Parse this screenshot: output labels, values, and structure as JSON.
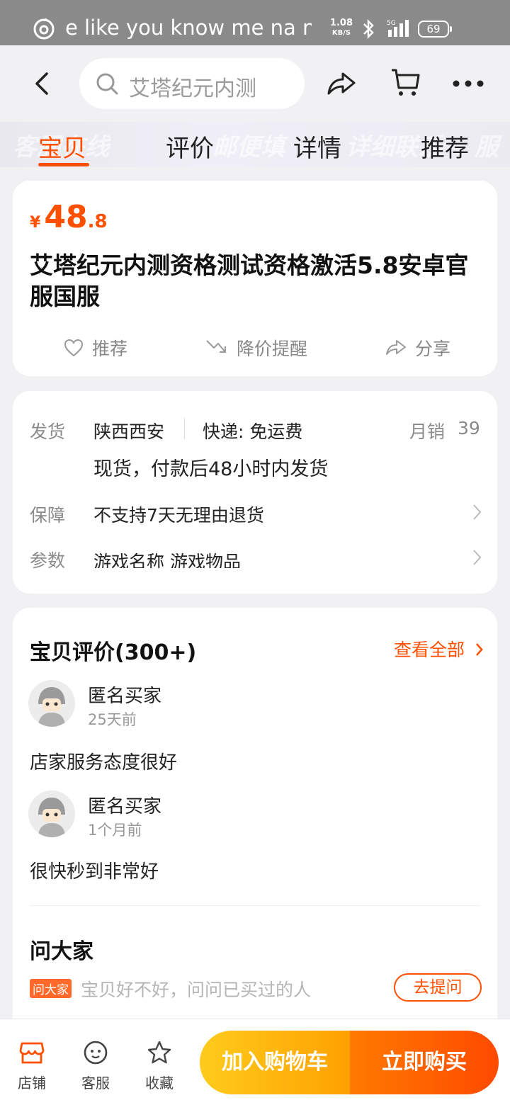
{
  "status_bar": {
    "now_playing": "e like you know me na na",
    "net_speed": "1.08",
    "net_unit": "KB/S",
    "network": "5G",
    "battery": "69"
  },
  "nav": {
    "search_placeholder": "艾塔纪元内测"
  },
  "tabs": [
    {
      "label": "宝贝",
      "active": true
    },
    {
      "label": "评价",
      "active": false
    },
    {
      "label": "详情",
      "active": false
    },
    {
      "label": "推荐",
      "active": false
    }
  ],
  "tab_banner_text": [
    "客服在线",
    "邮便填",
    "详细联系",
    "服"
  ],
  "product": {
    "currency": "¥",
    "price_int": "48",
    "price_dec": ".8",
    "title": "艾塔纪元内测资格测试资格激活5.8安卓官服国服",
    "actions": {
      "recommend": "推荐",
      "price_alert": "降价提醒",
      "share": "分享"
    }
  },
  "shipping": {
    "label": "发货",
    "location": "陕西西安",
    "express": "快递:  免运费",
    "sales_label": "月销",
    "sales_value": "39",
    "delivery_note": "现货，付款后48小时内发货",
    "guarantee_label": "保障",
    "guarantee_value": "不支持7天无理由退货",
    "params_label": "参数",
    "params_value": "游戏名称 游戏物品"
  },
  "reviews": {
    "title": "宝贝评价(300+)",
    "see_all": "查看全部",
    "items": [
      {
        "user": "匿名买家",
        "time": "25天前",
        "text": "店家服务态度很好"
      },
      {
        "user": "匿名买家",
        "time": "1个月前",
        "text": "很快秒到非常好"
      }
    ]
  },
  "ask": {
    "title": "问大家",
    "badge": "问大家",
    "placeholder": "宝贝好不好，问问已买过的人",
    "button": "去提问"
  },
  "bottom_bar": {
    "shop": "店铺",
    "service": "客服",
    "favorite": "收藏",
    "add_to_cart": "加入购物车",
    "buy_now": "立即购买"
  },
  "colors": {
    "accent": "#ff5000",
    "cart_button": "#ffb000",
    "buy_button": "#ff5a00"
  }
}
